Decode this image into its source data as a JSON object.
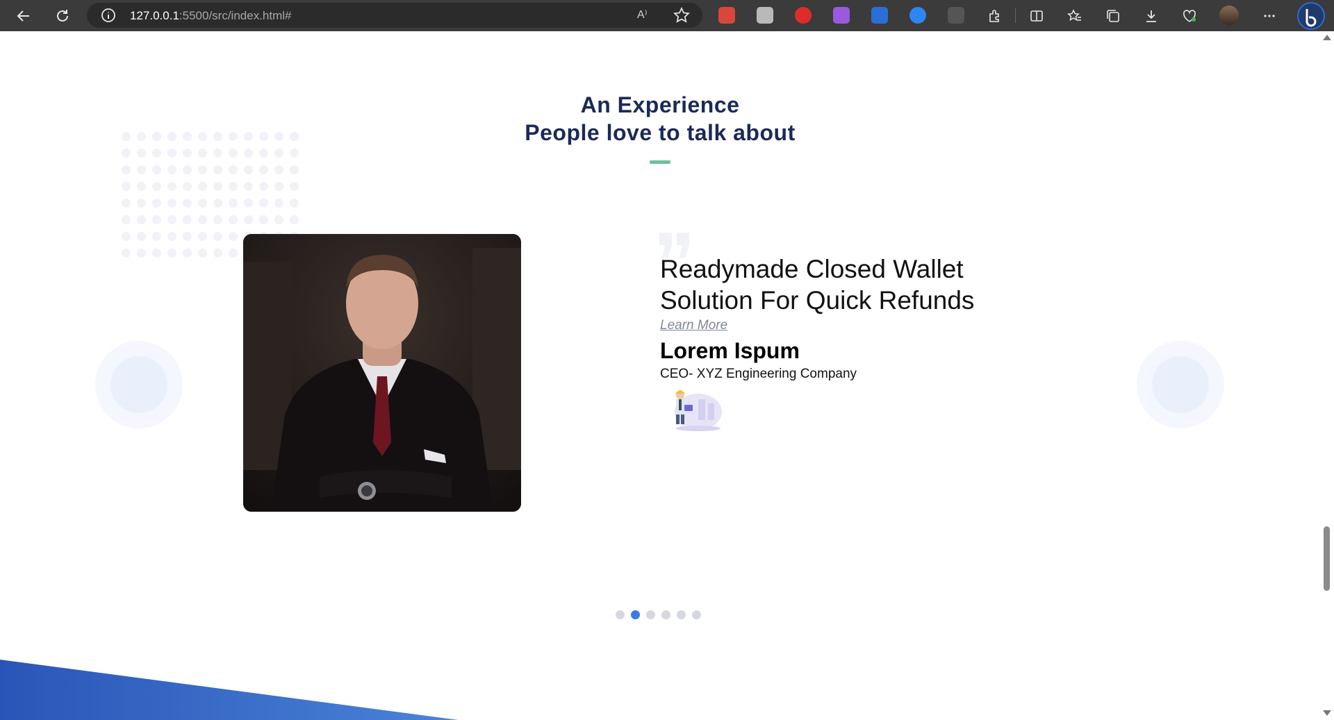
{
  "browser": {
    "url_host": "127.0.0.1",
    "url_rest": ":5500/src/index.html#",
    "read_aloud_label": "A⁾"
  },
  "testimonials": {
    "heading_line1": "An Experience",
    "heading_line2": "People love to talk about",
    "slide": {
      "title_line1": "Readymade Closed Wallet",
      "title_line2": "Solution For Quick Refunds",
      "link": "Learn More",
      "name": "Lorem Ispum",
      "role": "CEO- XYZ Engineering Company"
    },
    "pager": {
      "count": 6,
      "active_index": 1
    }
  },
  "colors": {
    "heading": "#1b2a57",
    "accent_underline": "#6cc19a",
    "pager_active": "#3b7be0",
    "wave_blue": "#2f5ec4"
  }
}
